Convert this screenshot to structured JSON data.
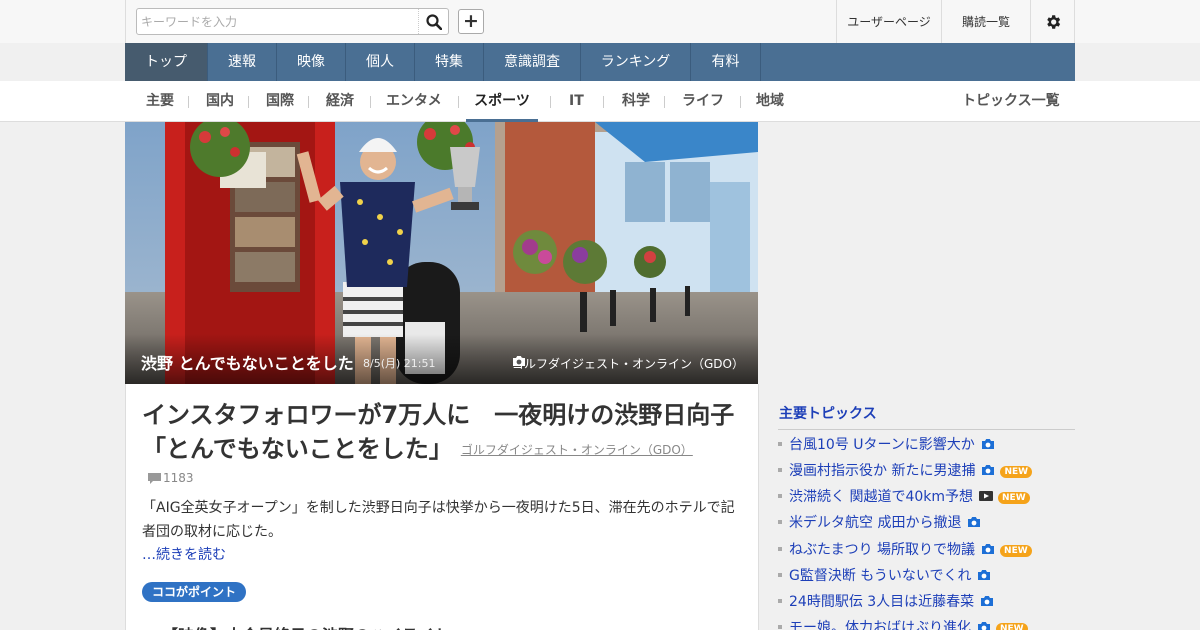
{
  "search": {
    "placeholder": "キーワードを入力",
    "value": ""
  },
  "header": {
    "user_page": "ユーザーページ",
    "subscriptions": "購読一覧"
  },
  "main_nav": [
    {
      "label": "トップ",
      "active": true
    },
    {
      "label": "速報"
    },
    {
      "label": "映像"
    },
    {
      "label": "個人"
    },
    {
      "label": "特集"
    },
    {
      "label": "意識調査"
    },
    {
      "label": "ランキング"
    },
    {
      "label": "有料"
    }
  ],
  "sub_nav": [
    {
      "label": "主要"
    },
    {
      "label": "国内"
    },
    {
      "label": "国際"
    },
    {
      "label": "経済"
    },
    {
      "label": "エンタメ"
    },
    {
      "label": "スポーツ",
      "active": true
    },
    {
      "label": "IT"
    },
    {
      "label": "科学"
    },
    {
      "label": "ライフ"
    },
    {
      "label": "地域"
    }
  ],
  "topics_all": "トピックス一覧",
  "hero": {
    "title": "渋野 とんでもないことをした",
    "time": "8/5(月) 21:51",
    "source": "ゴルフダイジェスト・オンライン（GDO）"
  },
  "article": {
    "title": "インスタフォロワーが7万人に　一夜明けの渋野日向子「とんでもないことをした」",
    "source": "ゴルフダイジェスト・オンライン（GDO）",
    "comments": "1183",
    "body": "「AIG全英女子オープン」を制した渋野日向子は快挙から一夜明けた5日、滞在先のホテルで記者団の取材に応じた。",
    "read_more": "…続きを読む",
    "point_badge": "ココがポイント",
    "next_heading": "【映像】大会最終日の渋野のハイライト"
  },
  "side": {
    "heading": "主要トピックス",
    "topics": [
      {
        "label": "台風10号 Uターンに影響大か",
        "icon": "camera-icon",
        "new": false
      },
      {
        "label": "漫画村指示役か 新たに男逮捕",
        "icon": "camera-icon",
        "new": true
      },
      {
        "label": "渋滞続く 関越道で40km予想",
        "icon": "video-icon",
        "new": true
      },
      {
        "label": "米デルタ航空 成田から撤退",
        "icon": "camera-icon",
        "new": false
      },
      {
        "label": "ねぶたまつり 場所取りで物議",
        "icon": "camera-icon",
        "new": true
      },
      {
        "label": "G監督決断 もういないでくれ",
        "icon": "camera-icon",
        "new": false
      },
      {
        "label": "24時間駅伝 3人目は近藤春菜",
        "icon": "camera-icon",
        "new": false
      },
      {
        "label": "モー娘。体力おばけぶり進化",
        "icon": "camera-icon",
        "new": true
      }
    ],
    "new_label": "NEW"
  },
  "colors": {
    "nav_blue": "#4a6f93",
    "link_blue": "#1d3fb8",
    "badge_blue": "#2f72c4",
    "new_orange": "#f5a31a"
  }
}
